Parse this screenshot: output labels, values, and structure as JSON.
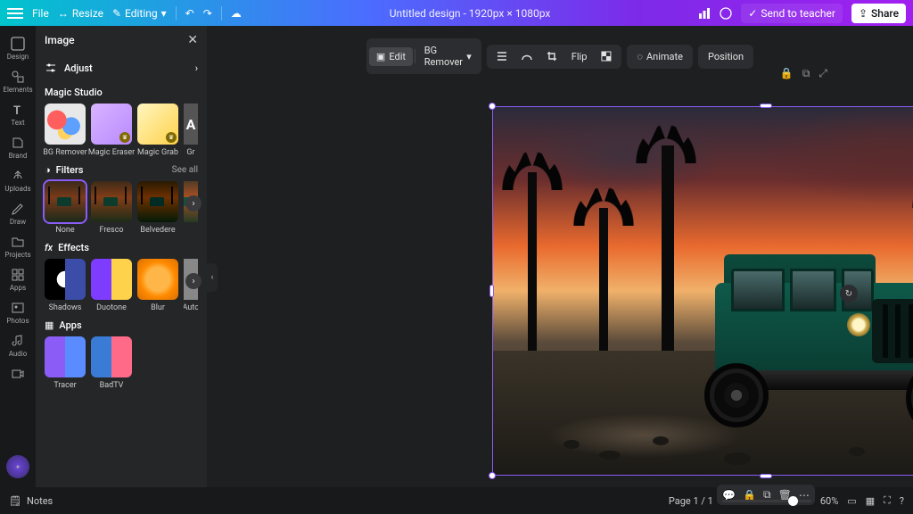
{
  "topbar": {
    "file": "File",
    "resize": "Resize",
    "editing": "Editing",
    "title": "Untitled design - 1920px × 1080px",
    "send": "Send to teacher",
    "share": "Share"
  },
  "rail": {
    "items": [
      "Design",
      "Elements",
      "Text",
      "Brand",
      "Uploads",
      "Draw",
      "Projects",
      "Apps",
      "Photos",
      "Audio"
    ]
  },
  "panel": {
    "title": "Image",
    "adjust": "Adjust",
    "magic_studio": {
      "title": "Magic Studio",
      "items": [
        "BG Remover",
        "Magic Eraser",
        "Magic Grab",
        "Gr"
      ]
    },
    "filters": {
      "title": "Filters",
      "see_all": "See all",
      "items": [
        "None",
        "Fresco",
        "Belvedere"
      ]
    },
    "effects": {
      "title": "Effects",
      "items": [
        "Shadows",
        "Duotone",
        "Blur",
        "Auto"
      ]
    },
    "apps": {
      "title": "Apps",
      "items": [
        "Tracer",
        "BadTV"
      ]
    }
  },
  "ctx": {
    "edit": "Edit",
    "bg_remover": "BG Remover",
    "flip": "Flip",
    "animate": "Animate",
    "position": "Position"
  },
  "bottom": {
    "notes": "Notes",
    "page": "Page 1 / 1",
    "zoom": "60%"
  }
}
